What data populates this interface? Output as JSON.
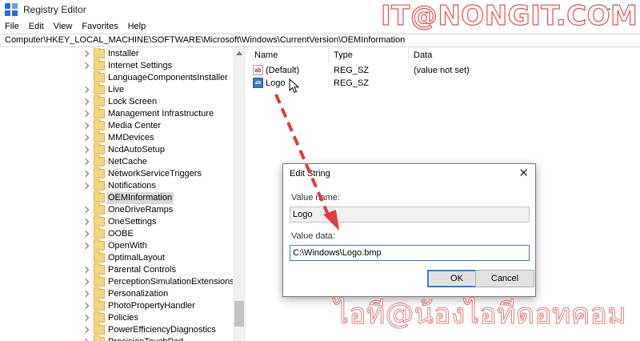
{
  "window": {
    "title": "Registry Editor",
    "icon": "regedit-icon"
  },
  "watermark": {
    "top": "IT@NONGIT.COM",
    "bottom": "ไอที@น้องไอทีดอทคอม"
  },
  "menu": [
    "File",
    "Edit",
    "View",
    "Favorites",
    "Help"
  ],
  "address": "Computer\\HKEY_LOCAL_MACHINE\\SOFTWARE\\Microsoft\\Windows\\CurrentVersion\\OEMInformation",
  "tree": {
    "items": [
      "Installer",
      "Internet Settings",
      "LanguageComponentsInstaller",
      "Live",
      "Lock Screen",
      "Management Infrastructure",
      "Media Center",
      "MMDevices",
      "NcdAutoSetup",
      "NetCache",
      "NetworkServiceTriggers",
      "Notifications",
      "OEMInformation",
      "OneDriveRamps",
      "OneSettings",
      "OOBE",
      "OpenWith",
      "OptimalLayout",
      "Parental Controls",
      "PerceptionSimulationExtensions",
      "Personalization",
      "PhotoPropertyHandler",
      "Policies",
      "PowerEfficiencyDiagnostics",
      "PrecisionTouchPad"
    ],
    "selected": "OEMInformation",
    "expandable": [
      true,
      true,
      false,
      true,
      true,
      true,
      true,
      true,
      true,
      true,
      true,
      true,
      false,
      true,
      true,
      true,
      true,
      false,
      true,
      true,
      true,
      true,
      true,
      true,
      true
    ]
  },
  "list": {
    "columns": [
      "Name",
      "Type",
      "Data"
    ],
    "rows": [
      {
        "name": "(Default)",
        "type": "REG_SZ",
        "data": "(value not set)",
        "icon": "ab"
      },
      {
        "name": "Logo",
        "type": "REG_SZ",
        "data": "",
        "icon": "ab"
      }
    ]
  },
  "dialog": {
    "title": "Edit String",
    "value_name_label": "Value name:",
    "value_name": "Logo",
    "value_data_label": "Value data:",
    "value_data": "C:\\Windows\\Logo.bmp",
    "ok": "OK",
    "cancel": "Cancel"
  },
  "colors": {
    "accent": "#2f7ed8",
    "arrow": "#e03c3c",
    "selection": "#d9d9d9",
    "folder": "#f2d77f"
  }
}
